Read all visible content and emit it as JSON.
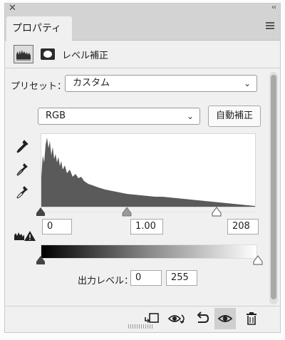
{
  "panel": {
    "close_glyph": "✕",
    "collapse_glyph": "‹‹",
    "tab_label": "プロパティ",
    "menu_icon": "hamburger-icon"
  },
  "adjustment": {
    "label": "レベル補正",
    "icons": [
      "levels-histogram-icon",
      "layer-mask-icon"
    ]
  },
  "preset": {
    "label": "プリセット：",
    "value": "カスタム",
    "chevron": "⌄"
  },
  "channel": {
    "value": "RGB",
    "chevron": "⌄",
    "auto_button": "自動補正"
  },
  "eyedroppers": [
    "black-point-eyedropper-icon",
    "gray-point-eyedropper-icon",
    "white-point-eyedropper-icon"
  ],
  "input_levels": {
    "shadow": "0",
    "midtone": "1.00",
    "highlight": "208"
  },
  "output_levels": {
    "label": "出力レベル：",
    "min": "0",
    "max": "255"
  },
  "bottom_icons": [
    "clip-to-layer-icon",
    "view-previous-state-icon",
    "reset-icon",
    "toggle-visibility-icon",
    "trash-icon"
  ],
  "colors": {
    "histogram_fill": "#5a5a5a",
    "panel_bg": "#f0f0f0",
    "titlebar_bg": "#d3d3d3"
  }
}
